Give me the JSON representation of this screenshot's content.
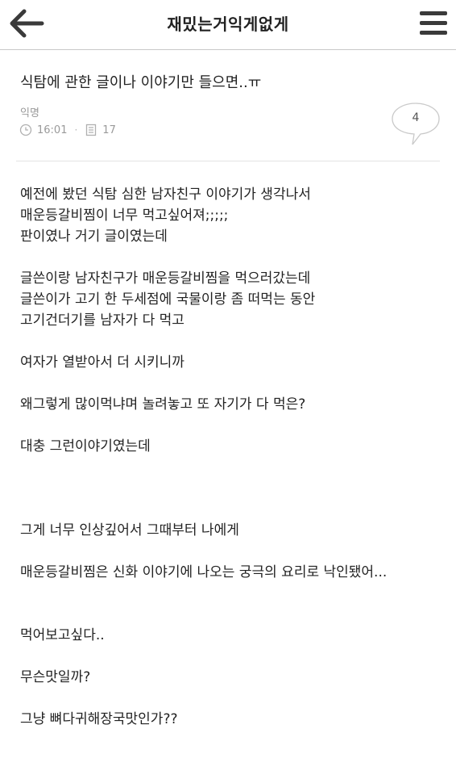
{
  "header": {
    "title": "재밌는거익게없게",
    "back_icon": "back-arrow-icon",
    "menu_icon": "hamburger-menu-icon"
  },
  "post": {
    "title": "식탐에 관한 글이나 이야기만 들으면..ㅠ",
    "author": "익명",
    "time": "16:01",
    "views": "17",
    "comment_count": "4",
    "body_lines": [
      "예전에 봤던 식탐 심한 남자친구 이야기가 생각나서",
      "매운등갈비찜이 너무 먹고싶어져;;;;;",
      "판이였나 거기 글이였는데",
      "",
      "글쓴이랑 남자친구가 매운등갈비찜을 먹으러갔는데",
      "글쓴이가 고기 한 두세점에 국물이랑 좀 떠먹는 동안",
      "고기건더기를 남자가 다 먹고",
      "",
      "여자가 열받아서 더 시키니까",
      "",
      "왜그렇게 많이먹냐며 놀려놓고 또 자기가 다 먹은?",
      "",
      "대충 그런이야기였는데",
      "",
      "",
      "",
      "그게 너무 인상깊어서 그때부터 나에게",
      "",
      "매운등갈비찜은 신화 이야기에 나오는 궁극의 요리로 낙인됐어...",
      "",
      "",
      "먹어보고싶다..",
      "",
      "무슨맛일까?",
      "",
      "그냥 뼈다귀해장국맛인가??"
    ]
  },
  "colors": {
    "meta_gray": "#9a9a9a",
    "divider": "#e3e3e3",
    "text": "#222222"
  }
}
